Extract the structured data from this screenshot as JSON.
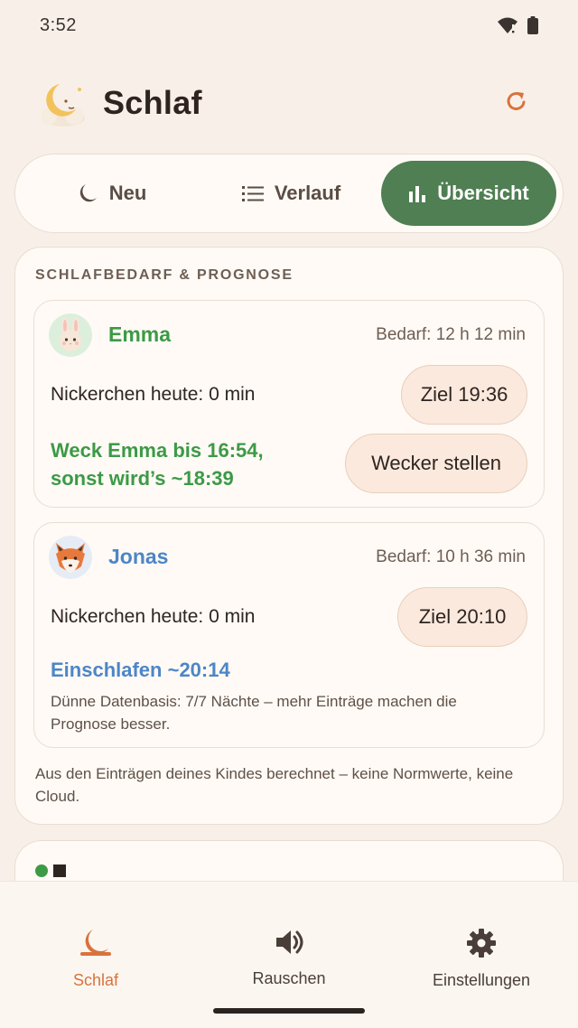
{
  "status": {
    "time": "3:52",
    "icons": [
      "wifi-icon",
      "battery-icon"
    ]
  },
  "header": {
    "title": "Schlaf",
    "logo": "moon-logo",
    "refresh_icon": "refresh-icon"
  },
  "tabs": [
    {
      "label": "Neu",
      "icon": "moon-icon",
      "active": false
    },
    {
      "label": "Verlauf",
      "icon": "list-icon",
      "active": false
    },
    {
      "label": "Übersicht",
      "icon": "bar-chart-icon",
      "active": true
    }
  ],
  "forecast_card": {
    "title": "SCHLAFBEDARF & PROGNOSE",
    "children": [
      {
        "name": "Emma",
        "avatar": "bunny-avatar",
        "need": "Bedarf: 12 h 12 min",
        "nap": "Nickerchen heute: 0 min",
        "target": "Ziel 19:36",
        "forecast": "Weck Emma bis 16:54, sonst wird’s ~18:39",
        "forecast_line1": "Weck Emma bis 16:54,",
        "forecast_line2": "sonst wird’s ~18:39",
        "action": "Wecker stellen",
        "color": "#3c9a47"
      },
      {
        "name": "Jonas",
        "avatar": "fox-avatar",
        "need": "Bedarf: 10 h 36 min",
        "nap": "Nickerchen heute: 0 min",
        "target": "Ziel 20:10",
        "forecast": "Einschlafen ~20:14",
        "note": "Dünne Datenbasis: 7/7 Nächte – mehr Einträge machen die Prognose besser.",
        "color": "#4d86c7"
      }
    ],
    "footer": "Aus den Einträgen deines Kindes berechnet – keine Normwerte, keine Cloud."
  },
  "bottom_nav": [
    {
      "label": "Schlaf",
      "icon": "moon-icon",
      "active": true
    },
    {
      "label": "Rauschen",
      "icon": "speaker-icon",
      "active": false
    },
    {
      "label": "Einstellungen",
      "icon": "gear-icon",
      "active": false
    }
  ],
  "colors": {
    "accent": "#d8733c",
    "active_tab": "#4f7f52",
    "emma": "#3c9a47",
    "jonas": "#4d86c7",
    "background": "#f8f0e8"
  }
}
